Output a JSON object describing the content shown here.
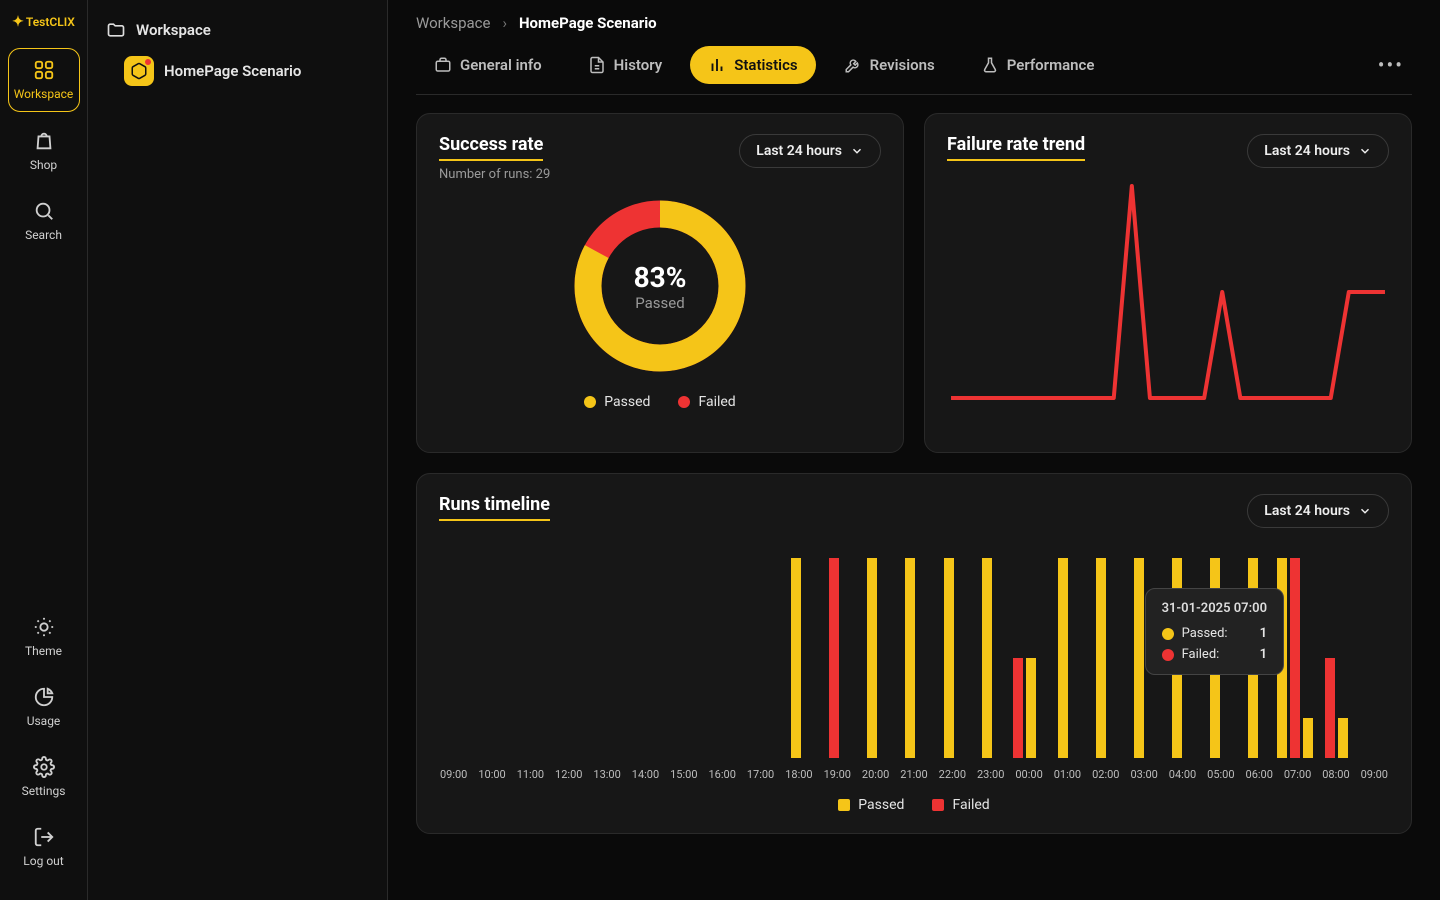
{
  "brand": "TestCLIX",
  "nav": {
    "workspace": "Workspace",
    "shop": "Shop",
    "search": "Search",
    "theme": "Theme",
    "usage": "Usage",
    "settings": "Settings",
    "logout": "Log out"
  },
  "tree": {
    "root": "Workspace",
    "scenario": "HomePage Scenario"
  },
  "breadcrumb": {
    "parent": "Workspace",
    "current": "HomePage Scenario"
  },
  "tabs": {
    "general": "General info",
    "history": "History",
    "statistics": "Statistics",
    "revisions": "Revisions",
    "performance": "Performance"
  },
  "range_label": "Last 24 hours",
  "colors": {
    "passed": "#f5c518",
    "failed": "#e33"
  },
  "success_card": {
    "title": "Success rate",
    "sub": "Number of runs: 29",
    "pct": "83%",
    "pct_label": "Passed",
    "legend_passed": "Passed",
    "legend_failed": "Failed"
  },
  "failure_card": {
    "title": "Failure rate trend"
  },
  "timeline_card": {
    "title": "Runs timeline",
    "legend_passed": "Passed",
    "legend_failed": "Failed"
  },
  "tooltip": {
    "title": "31-01-2025 07:00",
    "passed_label": "Passed:",
    "passed_val": "1",
    "failed_label": "Failed:",
    "failed_val": "1"
  },
  "chart_data": [
    {
      "type": "pie",
      "title": "Success rate",
      "series": [
        {
          "name": "Passed",
          "value": 83,
          "color": "#f5c518"
        },
        {
          "name": "Failed",
          "value": 17,
          "color": "#e33"
        }
      ],
      "center_label": "83% Passed",
      "total_runs": 29
    },
    {
      "type": "line",
      "title": "Failure rate trend",
      "x": [
        0,
        1,
        2,
        3,
        4,
        5,
        6,
        7,
        8,
        9,
        10,
        11,
        12,
        13,
        14,
        15,
        16,
        17,
        18,
        19,
        20,
        21,
        22,
        23,
        24
      ],
      "values": [
        0,
        0,
        0,
        0,
        0,
        0,
        0,
        0,
        0,
        0,
        1.0,
        0,
        0,
        0,
        0,
        0.5,
        0,
        0,
        0,
        0,
        0,
        0,
        0.5,
        0.5,
        0.5
      ],
      "ylim": [
        0,
        1
      ]
    },
    {
      "type": "bar",
      "title": "Runs timeline",
      "categories": [
        "09:00",
        "10:00",
        "11:00",
        "12:00",
        "13:00",
        "14:00",
        "15:00",
        "16:00",
        "17:00",
        "18:00",
        "19:00",
        "20:00",
        "21:00",
        "22:00",
        "23:00",
        "00:00",
        "01:00",
        "02:00",
        "03:00",
        "04:00",
        "05:00",
        "06:00",
        "07:00",
        "08:00",
        "09:00"
      ],
      "series": [
        {
          "name": "Passed",
          "color": "#f5c518",
          "values": [
            0,
            0,
            0,
            0,
            0,
            0,
            0,
            0,
            0,
            1,
            0,
            1,
            1,
            1,
            1,
            0,
            1,
            1,
            1,
            1,
            1,
            1,
            1,
            0,
            0
          ]
        },
        {
          "name": "Failed",
          "color": "#e33",
          "values": [
            0,
            0,
            0,
            0,
            0,
            0,
            0,
            0,
            0,
            0,
            1,
            0,
            0,
            0,
            0,
            0.5,
            0,
            0,
            0,
            0,
            0,
            0,
            1,
            0.5,
            0
          ]
        }
      ],
      "extra_passed_half": {
        "00:00": 0.5,
        "07:00": 0.2,
        "08:00": 0.2
      }
    }
  ]
}
